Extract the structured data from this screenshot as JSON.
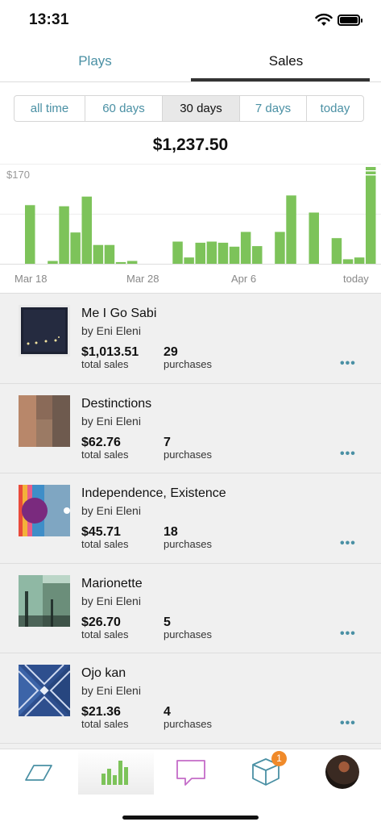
{
  "status": {
    "time": "13:31"
  },
  "tabs": [
    {
      "label": "Plays",
      "active": false
    },
    {
      "label": "Sales",
      "active": true
    }
  ],
  "ranges": [
    {
      "label": "all time",
      "active": false
    },
    {
      "label": "60 days",
      "active": false
    },
    {
      "label": "30 days",
      "active": true
    },
    {
      "label": "7 days",
      "active": false
    },
    {
      "label": "today",
      "active": false
    }
  ],
  "total": "$1,237.50",
  "chart_data": {
    "type": "bar",
    "ymax_label": "$170",
    "ylim": [
      0,
      170
    ],
    "xticks": [
      "Mar 18",
      "Mar 28",
      "Apr 6",
      "today"
    ],
    "values": [
      103,
      0,
      5,
      101,
      55,
      118,
      33,
      33,
      3,
      5,
      0,
      0,
      0,
      39,
      11,
      37,
      39,
      37,
      30,
      56,
      31,
      0,
      56,
      120,
      0,
      90,
      0,
      45,
      8,
      11,
      170
    ],
    "accent": "#7dc35a"
  },
  "items": [
    {
      "title": "Me I Go Sabi",
      "artist": "by Eni Eleni",
      "sales": "$1,013.51",
      "sales_label": "total sales",
      "count": "29",
      "count_label": "purchases",
      "more": "•••",
      "art": "dark-night-art-icon"
    },
    {
      "title": "Destinctions",
      "artist": "by Eni Eleni",
      "sales": "$62.76",
      "sales_label": "total sales",
      "count": "7",
      "count_label": "purchases",
      "more": "•••",
      "art": "brown-blocks-art-icon"
    },
    {
      "title": "Independence, Existence",
      "artist": "by Eni Eleni",
      "sales": "$45.71",
      "sales_label": "total sales",
      "count": "18",
      "count_label": "purchases",
      "more": "•••",
      "art": "colorful-stripes-art-icon"
    },
    {
      "title": "Marionette",
      "artist": "by Eni Eleni",
      "sales": "$26.70",
      "sales_label": "total sales",
      "count": "5",
      "count_label": "purchases",
      "more": "•••",
      "art": "green-texture-art-icon"
    },
    {
      "title": "Ojo kan",
      "artist": "by Eni Eleni",
      "sales": "$21.36",
      "sales_label": "total sales",
      "count": "4",
      "count_label": "purchases",
      "more": "•••",
      "art": "blue-pattern-art-icon"
    }
  ],
  "tabbar": {
    "items": [
      "feed-icon",
      "stats-icon",
      "messages-icon",
      "orders-icon",
      "profile-avatar"
    ],
    "badge": "1"
  }
}
